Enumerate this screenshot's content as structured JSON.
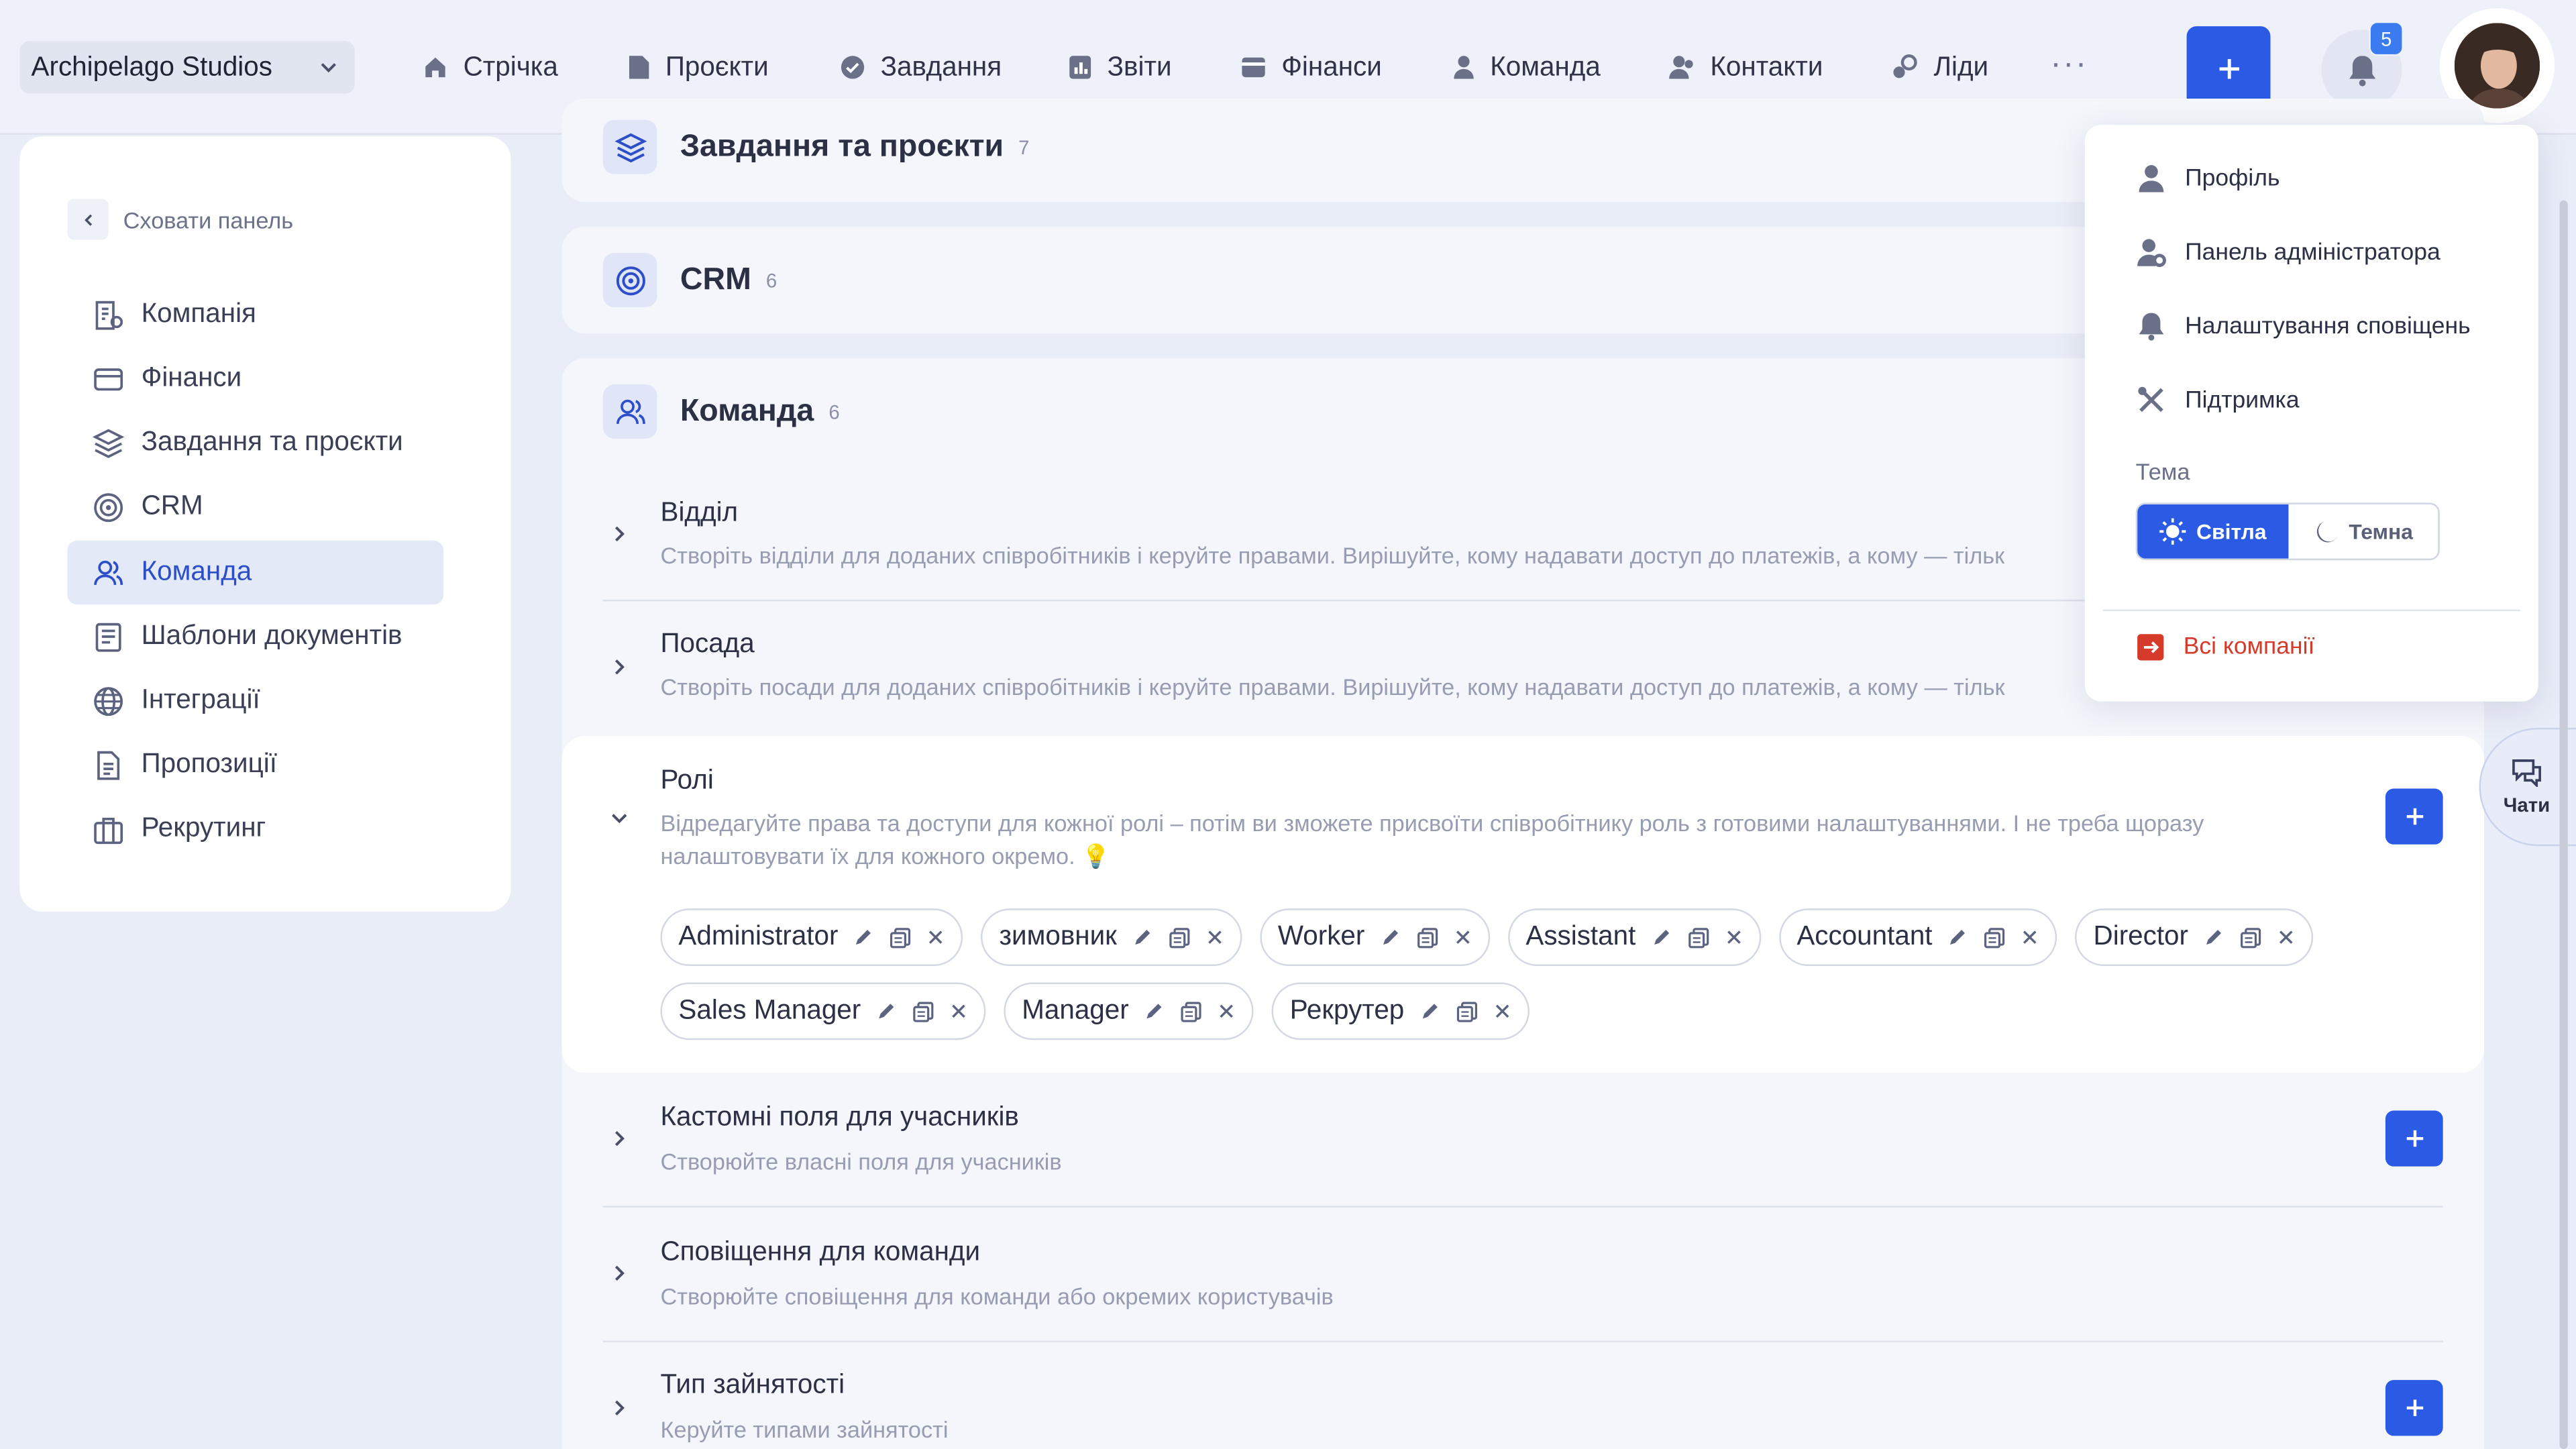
{
  "header": {
    "company": "Archipelago Studios",
    "nav": [
      {
        "label": "Стрічка",
        "icon": "home-icon"
      },
      {
        "label": "Проєкти",
        "icon": "file-icon"
      },
      {
        "label": "Завдання",
        "icon": "check-circle-icon"
      },
      {
        "label": "Звіти",
        "icon": "chart-icon"
      },
      {
        "label": "Фінанси",
        "icon": "wallet-icon"
      },
      {
        "label": "Команда",
        "icon": "user-icon"
      },
      {
        "label": "Контакти",
        "icon": "contacts-icon"
      },
      {
        "label": "Ліди",
        "icon": "leads-icon"
      }
    ],
    "more": "···",
    "notifications_count": "5",
    "accent": "#2b5be5"
  },
  "sidebar": {
    "hide_label": "Сховати панель",
    "items": [
      {
        "label": "Компанія",
        "icon": "company-icon"
      },
      {
        "label": "Фінанси",
        "icon": "card-icon"
      },
      {
        "label": "Завдання та проєкти",
        "icon": "layers-icon"
      },
      {
        "label": "CRM",
        "icon": "target-icon"
      },
      {
        "label": "Команда",
        "icon": "team-icon",
        "active": true
      },
      {
        "label": "Шаблони документів",
        "icon": "doc-template-icon"
      },
      {
        "label": "Інтеграції",
        "icon": "globe-icon"
      },
      {
        "label": "Пропозиції",
        "icon": "proposal-icon"
      },
      {
        "label": "Рекрутинг",
        "icon": "briefcase-icon"
      }
    ]
  },
  "main": {
    "sections": [
      {
        "title": "Завдання та проєкти",
        "count": "7"
      },
      {
        "title": "CRM",
        "count": "6"
      },
      {
        "title": "Команда",
        "count": "6"
      }
    ],
    "rows": [
      {
        "title": "Відділ",
        "desc": "Створіть відділи для доданих співробітників і керуйте правами. Вирішуйте, кому надавати доступ до платежів, а кому — тільк"
      },
      {
        "title": "Посада",
        "desc": "Створіть посади для доданих співробітників і керуйте правами. Вирішуйте, кому надавати доступ до платежів, а кому — тільк"
      },
      {
        "title": "Ролі",
        "desc": "Відредагуйте права та доступи для кожної ролі – потім ви зможете присвоїти співробітнику роль з готовими налаштуваннями. І не треба щоразу налаштовувати їх для кожного окремо. 💡"
      },
      {
        "title": "Кастомні поля для учасників",
        "desc": "Створюйте власні поля для учасників"
      },
      {
        "title": "Сповіщення для команди",
        "desc": "Створюйте сповіщення для команди або окремих користувачів"
      },
      {
        "title": "Тип зайнятості",
        "desc": "Керуйте типами зайнятості"
      }
    ],
    "roles": [
      "Administrator",
      "зимовник",
      "Worker",
      "Assistant",
      "Accountant",
      "Director",
      "Sales Manager",
      "Manager",
      "Рекрутер"
    ]
  },
  "menu": {
    "items": [
      {
        "label": "Профіль",
        "icon": "person-icon"
      },
      {
        "label": "Панель адміністратора",
        "icon": "admin-icon"
      },
      {
        "label": "Налаштування сповіщень",
        "icon": "bell-icon"
      },
      {
        "label": "Підтримка",
        "icon": "tools-icon"
      }
    ],
    "theme_label": "Тема",
    "theme_light": "Світла",
    "theme_dark": "Темна",
    "all_companies": "Всі компанії"
  },
  "chats_label": "Чати"
}
